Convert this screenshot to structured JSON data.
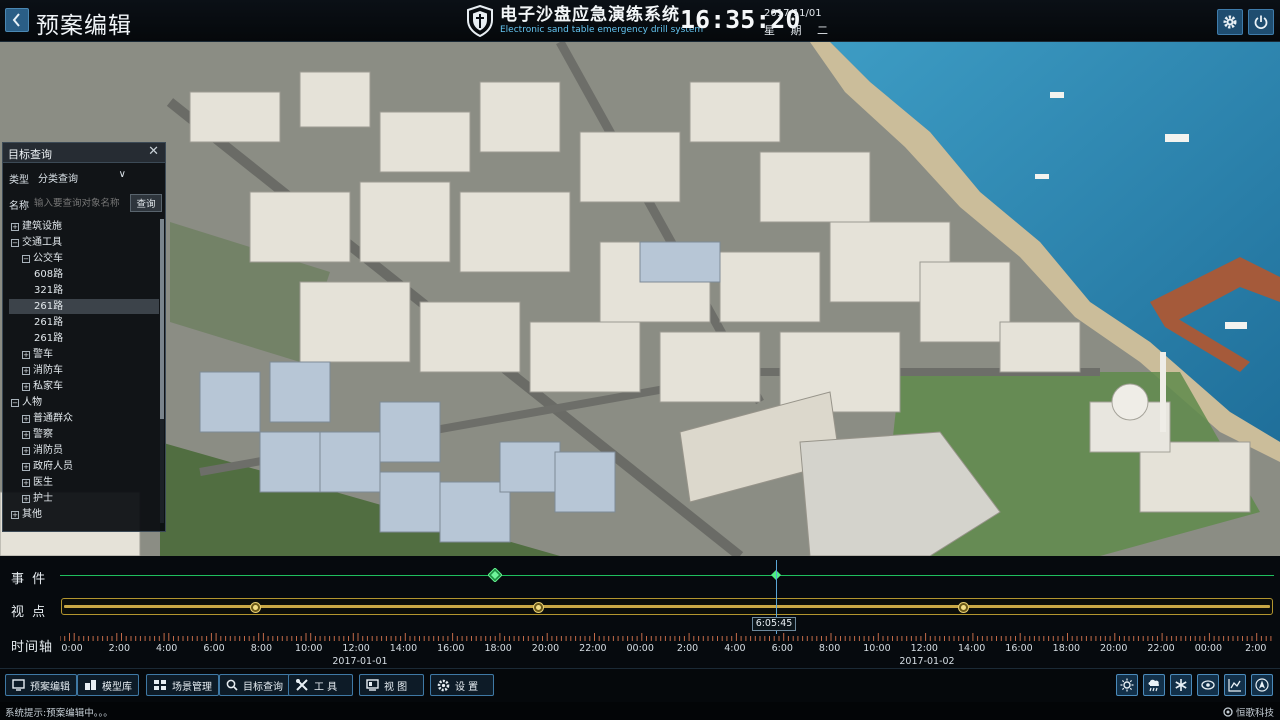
{
  "header": {
    "back_icon": "chevron-left-icon",
    "page_title": "预案编辑",
    "app_title": "电子沙盘应急演练系统",
    "app_subtitle": "Electronic sand table emergency drill system",
    "time": "16:35:20",
    "date": "2017/11/01",
    "weekday": "星 期 二",
    "settings_icon": "gear-icon",
    "power_icon": "power-icon"
  },
  "query_panel": {
    "title": "目标查询",
    "type_label": "类型",
    "type_value": "分类查询",
    "name_label": "名称",
    "name_placeholder": "输入要查询对象名称",
    "search_label": "查询",
    "tree": [
      {
        "label": "建筑设施",
        "level": 0,
        "expander": "+"
      },
      {
        "label": "交通工具",
        "level": 0,
        "expander": "−"
      },
      {
        "label": "公交车",
        "level": 1,
        "expander": "−"
      },
      {
        "label": "608路",
        "level": 2,
        "expander": ""
      },
      {
        "label": "321路",
        "level": 2,
        "expander": ""
      },
      {
        "label": "261路",
        "level": 2,
        "expander": "",
        "selected": true
      },
      {
        "label": "261路",
        "level": 2,
        "expander": ""
      },
      {
        "label": "261路",
        "level": 2,
        "expander": ""
      },
      {
        "label": "警车",
        "level": 1,
        "expander": "+"
      },
      {
        "label": "消防车",
        "level": 1,
        "expander": "+"
      },
      {
        "label": "私家车",
        "level": 1,
        "expander": "+"
      },
      {
        "label": "人物",
        "level": 0,
        "expander": "−"
      },
      {
        "label": "普通群众",
        "level": 1,
        "expander": "+"
      },
      {
        "label": "警察",
        "level": 1,
        "expander": "+"
      },
      {
        "label": "消防员",
        "level": 1,
        "expander": "+"
      },
      {
        "label": "政府人员",
        "level": 1,
        "expander": "+"
      },
      {
        "label": "医生",
        "level": 1,
        "expander": "+"
      },
      {
        "label": "护士",
        "level": 1,
        "expander": "+"
      },
      {
        "label": "其他",
        "level": 0,
        "expander": "+"
      }
    ]
  },
  "timeline": {
    "event_label": "事 件",
    "view_label": "视 点",
    "axis_label": "时间轴",
    "cursor_time": "6:05:45",
    "tick_labels": [
      "0:00",
      "2:00",
      "4:00",
      "6:00",
      "8:00",
      "10:00",
      "12:00",
      "14:00",
      "16:00",
      "18:00",
      "20:00",
      "22:00",
      "00:00",
      "2:00",
      "4:00",
      "6:00",
      "8:00",
      "10:00",
      "12:00",
      "14:00",
      "16:00",
      "18:00",
      "20:00",
      "22:00",
      "00:00",
      "2:00"
    ],
    "dates": [
      "2017-01-01",
      "2017-01-02"
    ]
  },
  "toolbar": {
    "buttons": [
      {
        "label": "预案编辑",
        "icon": "monitor-icon"
      },
      {
        "label": "模型库",
        "icon": "model-library-icon"
      },
      {
        "label": "场景管理",
        "icon": "scene-management-icon"
      },
      {
        "label": "目标查询",
        "icon": "target-search-icon"
      },
      {
        "label": "工 具",
        "icon": "tools-icon"
      },
      {
        "label": "视 图",
        "icon": "view-icon"
      },
      {
        "label": "设 置",
        "icon": "gear-icon"
      }
    ],
    "weather_icons": [
      "sun-icon",
      "rain-icon",
      "snow-icon",
      "eye-icon",
      "chart-icon",
      "compass-icon"
    ]
  },
  "status": {
    "text": "系统提示:预案编辑中。。。",
    "company": "恒歌科技"
  },
  "colors": {
    "accent": "#3f79a5",
    "event_track": "#1fbf5e",
    "view_track": "#c8a745",
    "cursor": "#5aa6d6"
  }
}
